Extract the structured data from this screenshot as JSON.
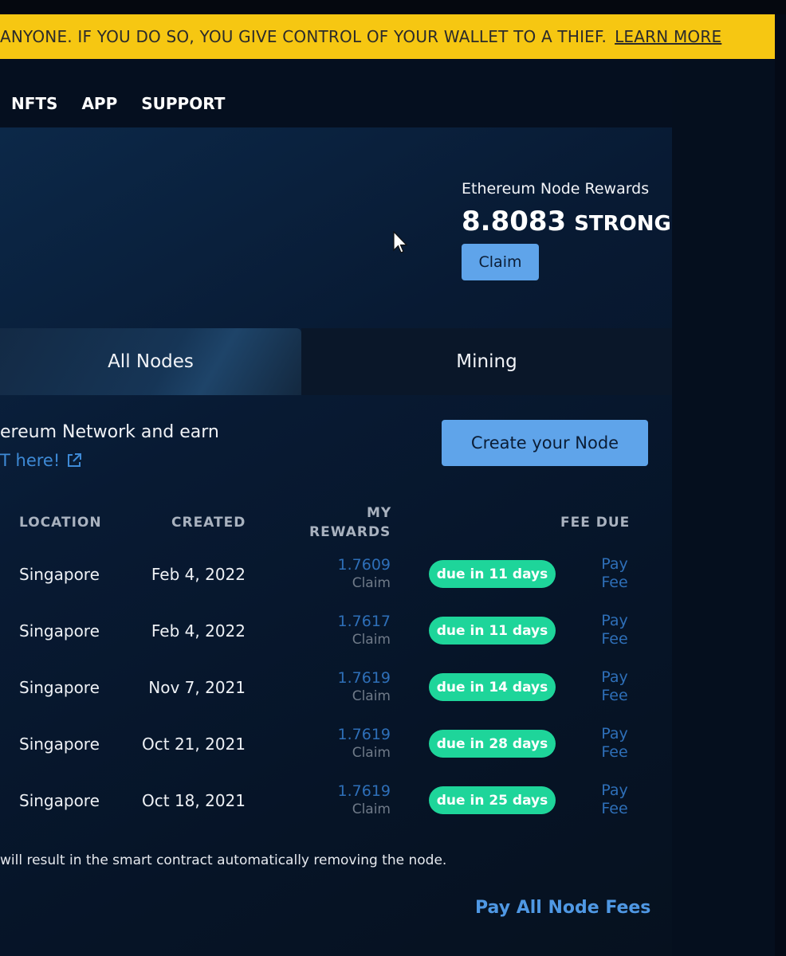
{
  "banner": {
    "text": "ANYONE. IF YOU DO SO, YOU GIVE CONTROL OF YOUR WALLET TO A THIEF.",
    "link": "LEARN MORE"
  },
  "nav": [
    "NFTS",
    "APP",
    "SUPPORT"
  ],
  "rewards": {
    "label": "Ethereum Node Rewards",
    "value": "8.8083",
    "unit": "STRONG",
    "claim": "Claim"
  },
  "tabs": [
    "All Nodes",
    "Mining"
  ],
  "intro": {
    "text": "ereum Network and earn",
    "link": "T here!"
  },
  "create_button": "Create your Node",
  "table": {
    "headers": {
      "location": "LOCATION",
      "created": "CREATED",
      "rewards_line1": "MY",
      "rewards_line2": "REWARDS",
      "fee_due": "FEE DUE"
    },
    "rows": [
      {
        "location": "Singapore",
        "created": "Feb 4, 2022",
        "reward": "1.7609",
        "claim": "Claim",
        "due": "due in 11 days",
        "pay1": "Pay",
        "pay2": "Fee"
      },
      {
        "location": "Singapore",
        "created": "Feb 4, 2022",
        "reward": "1.7617",
        "claim": "Claim",
        "due": "due in 11 days",
        "pay1": "Pay",
        "pay2": "Fee"
      },
      {
        "location": "Singapore",
        "created": "Nov 7, 2021",
        "reward": "1.7619",
        "claim": "Claim",
        "due": "due in 14 days",
        "pay1": "Pay",
        "pay2": "Fee"
      },
      {
        "location": "Singapore",
        "created": "Oct 21, 2021",
        "reward": "1.7619",
        "claim": "Claim",
        "due": "due in 28 days",
        "pay1": "Pay",
        "pay2": "Fee"
      },
      {
        "location": "Singapore",
        "created": "Oct 18, 2021",
        "reward": "1.7619",
        "claim": "Claim",
        "due": "due in 25 days",
        "pay1": "Pay",
        "pay2": "Fee"
      }
    ]
  },
  "footnote": "will result in the smart contract automatically removing the node.",
  "pay_all": "Pay All Node Fees",
  "colors": {
    "banner": "#f6c712",
    "primary_button": "#5fa4ea",
    "badge": "#1ed59a",
    "link": "#2e6fb8"
  }
}
